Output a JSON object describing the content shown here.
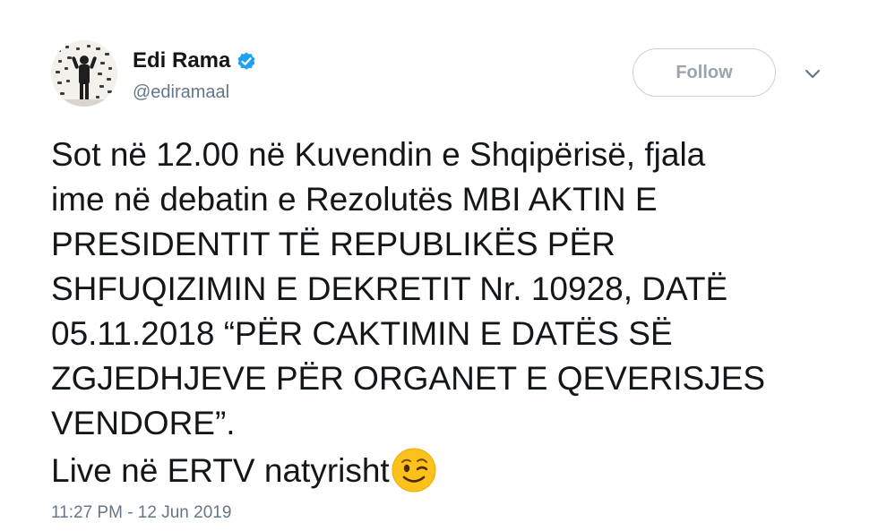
{
  "user": {
    "display_name": "Edi Rama",
    "handle": "@ediramaal",
    "verified_icon": "verified-badge-icon",
    "verified_color": "#1da1f2"
  },
  "actions": {
    "follow_label": "Follow",
    "more_icon": "chevron-down-icon"
  },
  "tweet": {
    "lines": [
      "Sot në 12.00 në Kuvendin e Shqipërisë, fjala",
      "ime në debatin e Rezolutës MBI AKTIN E",
      "PRESIDENTIT TË REPUBLIKËS PËR",
      "SHFUQIZIMIN E DEKRETIT Nr. 10928, DATË",
      "05.11.2018 “PËR CAKTIMIN E DATËS SË",
      "ZGJEDHJEVE PËR ORGANET E QEVERISJES",
      "VENDORE”.",
      "Live në ERTV natyrisht"
    ],
    "emoji_icon": "winking-face-icon",
    "timestamp": "11:27 PM - 12 Jun 2019"
  }
}
